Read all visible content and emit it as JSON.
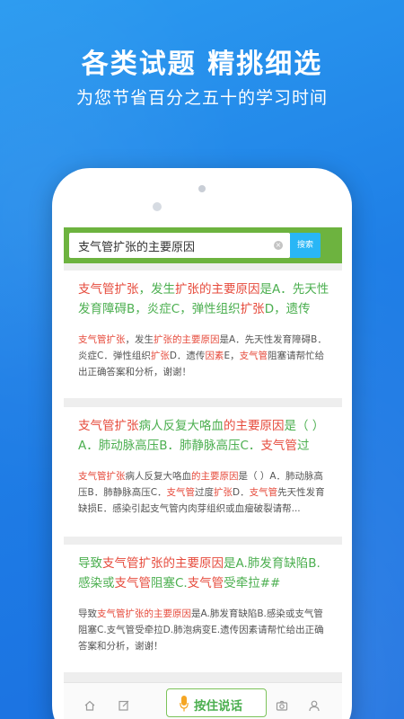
{
  "promo": {
    "headline": "各类试题 精挑细选",
    "subheadline": "为您节省百分之五十的学习时间"
  },
  "search": {
    "query": "支气管扩张的主要原因",
    "button_label": "搜索",
    "clear_glyph": "×"
  },
  "results": [
    {
      "title_segments": [
        {
          "text": "支气管扩张",
          "color": "red"
        },
        {
          "text": "，发生",
          "color": "green"
        },
        {
          "text": "扩张的主要原因",
          "color": "red"
        },
        {
          "text": "是A．先天性发育障碍B，炎症C，弹性组织",
          "color": "green"
        },
        {
          "text": "扩张",
          "color": "red"
        },
        {
          "text": "D，遗传因...",
          "color": "green"
        }
      ],
      "body_segments": [
        {
          "text": "支气管扩张",
          "color": "red"
        },
        {
          "text": "，发生",
          "color": "plain"
        },
        {
          "text": "扩张的主要原因",
          "color": "red"
        },
        {
          "text": "是A．先天性发育障碍B．炎症C．弹性组织",
          "color": "plain"
        },
        {
          "text": "扩张",
          "color": "red"
        },
        {
          "text": "D．遗传",
          "color": "plain"
        },
        {
          "text": "因素",
          "color": "red"
        },
        {
          "text": "E，",
          "color": "plain"
        },
        {
          "text": "支气管",
          "color": "red"
        },
        {
          "text": "阻塞请帮忙给出正确答案和分析，谢谢！",
          "color": "plain"
        }
      ]
    },
    {
      "title_segments": [
        {
          "text": "支气管扩张",
          "color": "red"
        },
        {
          "text": "病人反复大咯血",
          "color": "green"
        },
        {
          "text": "的主要原因",
          "color": "red"
        },
        {
          "text": "是（ ）A．肺动脉高压B．肺静脉高压C．",
          "color": "green"
        },
        {
          "text": "支气管",
          "color": "red"
        },
        {
          "text": "过度...",
          "color": "green"
        }
      ],
      "body_segments": [
        {
          "text": "支气管扩张",
          "color": "red"
        },
        {
          "text": "病人反复大咯血",
          "color": "plain"
        },
        {
          "text": "的主要原因",
          "color": "red"
        },
        {
          "text": "是（ ）A．肺动脉高压B．肺静脉高压C．",
          "color": "plain"
        },
        {
          "text": "支气管",
          "color": "red"
        },
        {
          "text": "过度",
          "color": "plain"
        },
        {
          "text": "扩张",
          "color": "red"
        },
        {
          "text": "D．",
          "color": "plain"
        },
        {
          "text": "支气管",
          "color": "red"
        },
        {
          "text": "先天性发育缺损E．感染引起支气管内肉芽组织或血瘤破裂请帮...",
          "color": "plain"
        }
      ]
    },
    {
      "title_segments": [
        {
          "text": "导致",
          "color": "green"
        },
        {
          "text": "支气管扩张的主要原因",
          "color": "red"
        },
        {
          "text": "是A.肺发育缺陷B.感染或",
          "color": "green"
        },
        {
          "text": "支气管",
          "color": "red"
        },
        {
          "text": "阻塞C.",
          "color": "green"
        },
        {
          "text": "支气管",
          "color": "red"
        },
        {
          "text": "受牵拉##",
          "color": "green"
        }
      ],
      "body_segments": [
        {
          "text": "导致",
          "color": "plain"
        },
        {
          "text": "支气管扩张的主要原因",
          "color": "red"
        },
        {
          "text": "是A.肺发育缺陷B.感染或支气管阻塞C.支气管受牵拉D.肺泡病变E.遗传因素请帮忙给出正确答案和分析，谢谢！",
          "color": "plain"
        }
      ]
    }
  ],
  "bottom_bar": {
    "voice_label": "按住说话",
    "icons": [
      "home-icon",
      "edit-icon",
      "microphone-icon",
      "camera-icon",
      "user-icon"
    ]
  },
  "colors": {
    "background": "#1f7fe6",
    "search_bar": "#6db33f",
    "search_button": "#29b6f6",
    "highlight_red": "#e64a3b",
    "title_green": "#4caf50"
  }
}
